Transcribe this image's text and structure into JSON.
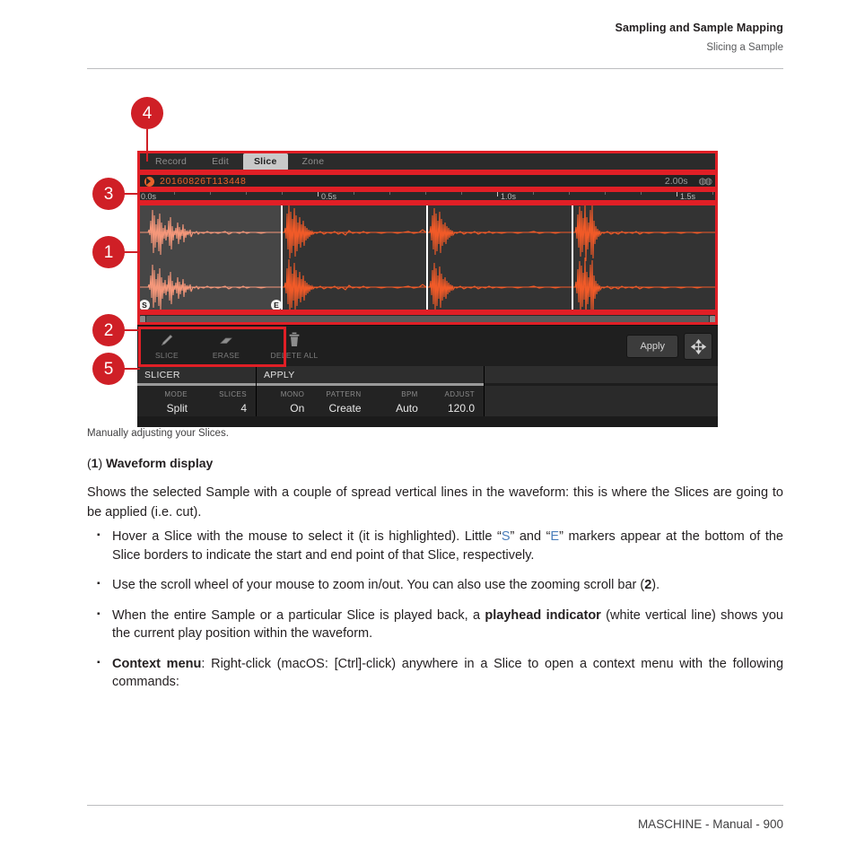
{
  "header": {
    "title": "Sampling and Sample Mapping",
    "subtitle": "Slicing a Sample"
  },
  "footer": {
    "text": "MASCHINE - Manual - 900"
  },
  "figure": {
    "callouts": [
      {
        "id": "4",
        "label": "4"
      },
      {
        "id": "3",
        "label": "3"
      },
      {
        "id": "1",
        "label": "1"
      },
      {
        "id": "2",
        "label": "2"
      },
      {
        "id": "5",
        "label": "5"
      }
    ],
    "caption": "Manually adjusting your Slices."
  },
  "ui": {
    "tabs": [
      {
        "label": "Record",
        "active": false
      },
      {
        "label": "Edit",
        "active": false
      },
      {
        "label": "Slice",
        "active": true
      },
      {
        "label": "Zone",
        "active": false
      }
    ],
    "sample": {
      "name": "20160826T113448",
      "duration": "2.00s",
      "channel_icon": "stereo-icon",
      "play_icon": "play-icon"
    },
    "ruler": {
      "labels": [
        "0.0s",
        "0.5s",
        "1.0s",
        "1.5s"
      ],
      "positions_pct": [
        0.5,
        25.0,
        50.0,
        75.0
      ]
    },
    "waveform": {
      "slice_boundaries_pct": [
        24.8,
        49.6,
        74.4
      ],
      "selected_slice": 1,
      "start_marker": "S",
      "end_marker": "E",
      "wave_color": "#f05a28",
      "wave_color_selected": "#f4977a"
    },
    "zoom_scrollbar": {
      "name": "zoom-scroll-bar"
    },
    "tools": [
      {
        "label": "SLICE",
        "icon": "pencil-icon"
      },
      {
        "label": "ERASE",
        "icon": "eraser-icon"
      },
      {
        "label": "DELETE ALL",
        "icon": "trash-icon"
      }
    ],
    "apply_button": "Apply",
    "move_button_icon": "move-icon",
    "param_groups": [
      {
        "title": "SLICER",
        "params": [
          {
            "label": "MODE",
            "value": "Split"
          },
          {
            "label": "SLICES",
            "value": "4"
          }
        ]
      },
      {
        "title": "APPLY",
        "params": [
          {
            "label": "MONO",
            "value": "On"
          },
          {
            "label": "PATTERN",
            "value": "Create"
          },
          {
            "label": "BPM",
            "value": "Auto"
          },
          {
            "label": "ADJUST",
            "value": "120.0"
          }
        ]
      }
    ]
  },
  "content": {
    "subhead_num": "(1)",
    "subhead_title": "Waveform display",
    "paragraph": "Shows the selected Sample with a couple of spread vertical lines in the waveform: this is where the Slices are going to be applied (i.e. cut).",
    "bullets": [
      {
        "id": "b1",
        "parts": [
          {
            "t": "Hover a Slice with the mouse to select it (it is highlighted). Little “",
            "s": "n"
          },
          {
            "t": "S",
            "s": "blue"
          },
          {
            "t": "” and “",
            "s": "n"
          },
          {
            "t": "E",
            "s": "blue"
          },
          {
            "t": "” markers appear at the bottom of the Slice borders to indicate the start and end point of that Slice, respectively.",
            "s": "n"
          }
        ]
      },
      {
        "id": "b2",
        "parts": [
          {
            "t": "Use the scroll wheel of your mouse to zoom in/out. You can also use the zooming scroll bar (",
            "s": "n"
          },
          {
            "t": "2",
            "s": "b"
          },
          {
            "t": ").",
            "s": "n"
          }
        ]
      },
      {
        "id": "b3",
        "parts": [
          {
            "t": "When the entire Sample or a particular Slice is played back, a ",
            "s": "n"
          },
          {
            "t": "playhead indicator",
            "s": "b"
          },
          {
            "t": " (white vertical line) shows you the current play position within the waveform.",
            "s": "n"
          }
        ]
      },
      {
        "id": "b4",
        "parts": [
          {
            "t": "Context menu",
            "s": "b"
          },
          {
            "t": ": Right-click (macOS: [Ctrl]-click) anywhere in a Slice to open a context menu with the following commands:",
            "s": "n"
          }
        ]
      }
    ]
  },
  "colors": {
    "accent_red": "#cf1f26",
    "highlight_red": "#e01f26",
    "waveform_orange": "#f05a28",
    "link_blue": "#4a7ebb"
  }
}
